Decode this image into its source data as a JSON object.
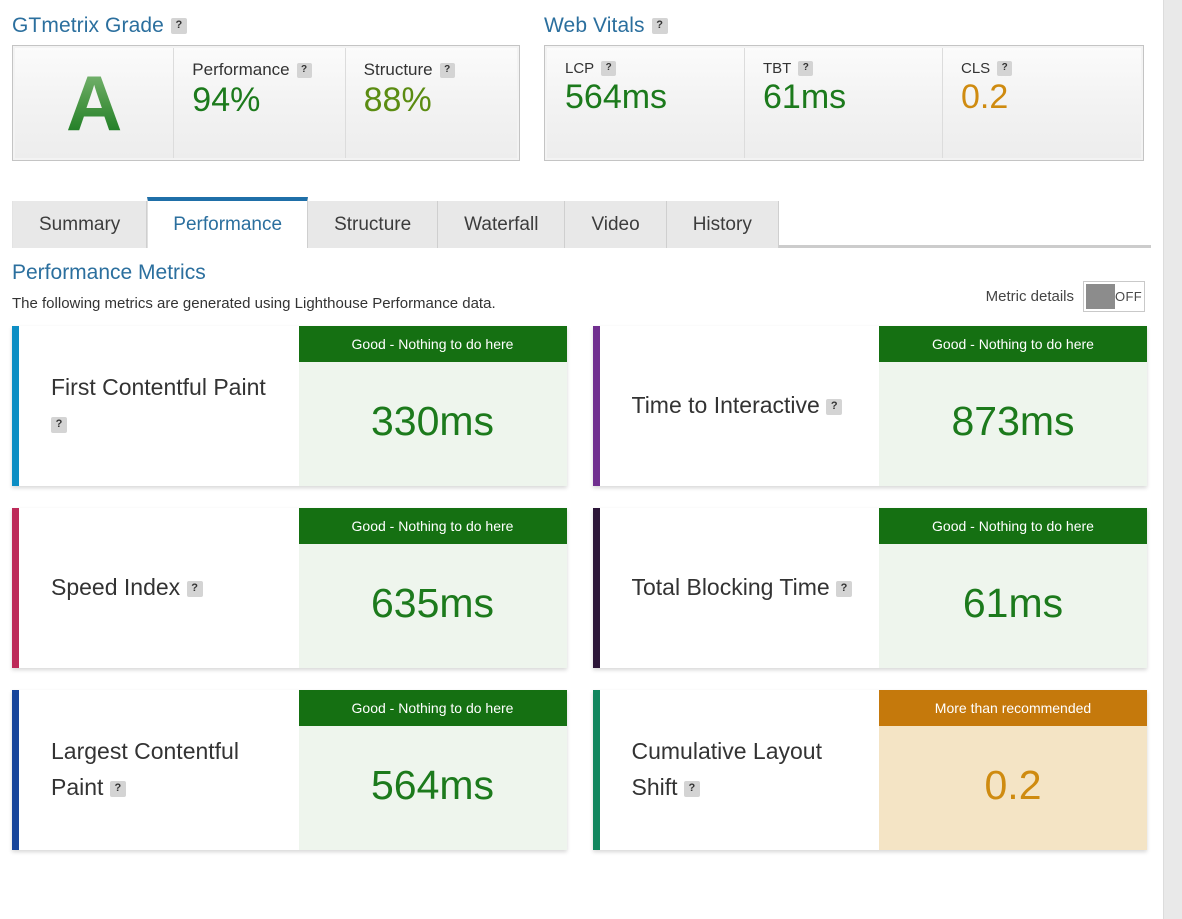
{
  "scorecards": {
    "grade": {
      "heading": "GTmetrix Grade",
      "help": "?",
      "letter": "A",
      "metrics": [
        {
          "name": "Performance",
          "help": "?",
          "value": "94%",
          "color": "#1c7a1c"
        },
        {
          "name": "Structure",
          "help": "?",
          "value": "88%",
          "color": "#5b8c12"
        }
      ]
    },
    "web_vitals": {
      "heading": "Web Vitals",
      "help": "?",
      "metrics": [
        {
          "name": "LCP",
          "help": "?",
          "value": "564ms",
          "color": "#1c7a1c"
        },
        {
          "name": "TBT",
          "help": "?",
          "value": "61ms",
          "color": "#1c7a1c"
        },
        {
          "name": "CLS",
          "help": "?",
          "value": "0.2",
          "color": "#cf8b10"
        }
      ]
    }
  },
  "tabs": [
    {
      "label": "Summary",
      "active": false
    },
    {
      "label": "Performance",
      "active": true
    },
    {
      "label": "Structure",
      "active": false
    },
    {
      "label": "Waterfall",
      "active": false
    },
    {
      "label": "Video",
      "active": false
    },
    {
      "label": "History",
      "active": false
    }
  ],
  "section": {
    "title": "Performance Metrics",
    "description": "The following metrics are generated using Lighthouse Performance data."
  },
  "metric_details_toggle": {
    "label": "Metric details",
    "state": "OFF",
    "on": false,
    "knob_color": "#8c8c8c"
  },
  "metric_cards": [
    {
      "label": "First Contentful Paint",
      "help": "?",
      "accent": "#0d8ec4",
      "status": "Good - Nothing to do here",
      "status_color": "#157012",
      "value": "330ms",
      "value_color": "#1c7a1c",
      "value_bg": "#eef5ed"
    },
    {
      "label": "Time to Interactive",
      "help": "?",
      "accent": "#702f8f",
      "status": "Good - Nothing to do here",
      "status_color": "#157012",
      "value": "873ms",
      "value_color": "#1c7a1c",
      "value_bg": "#eef5ed"
    },
    {
      "label": "Speed Index",
      "help": "?",
      "accent": "#bd2a59",
      "status": "Good - Nothing to do here",
      "status_color": "#157012",
      "value": "635ms",
      "value_color": "#1c7a1c",
      "value_bg": "#eef5ed"
    },
    {
      "label": "Total Blocking Time",
      "help": "?",
      "accent": "#2c1638",
      "status": "Good - Nothing to do here",
      "status_color": "#157012",
      "value": "61ms",
      "value_color": "#1c7a1c",
      "value_bg": "#eef5ed"
    },
    {
      "label": "Largest Contentful Paint",
      "help": "?",
      "accent": "#17459b",
      "status": "Good - Nothing to do here",
      "status_color": "#157012",
      "value": "564ms",
      "value_color": "#1c7a1c",
      "value_bg": "#eef5ed"
    },
    {
      "label": "Cumulative Layout Shift",
      "help": "?",
      "accent": "#12865e",
      "status": "More than recommended",
      "status_color": "#c5790c",
      "value": "0.2",
      "value_color": "#cf8b10",
      "value_bg": "#f4e4c5"
    }
  ],
  "theme": {
    "heading_blue": "#2b6f9e",
    "tab_active_border": "#1f6fa8",
    "good_green": "#1c7a1c",
    "warn_orange": "#cf8b10"
  }
}
